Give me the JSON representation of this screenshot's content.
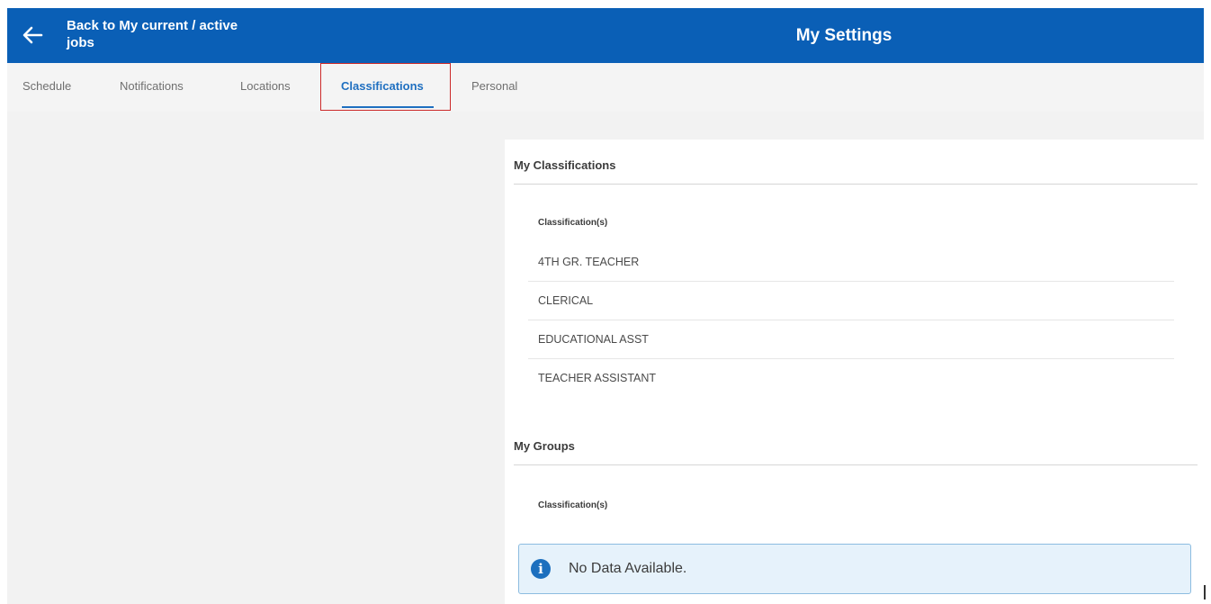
{
  "header": {
    "back_label": "Back to My current / active jobs",
    "title": "My Settings"
  },
  "tabs": [
    {
      "label": "Schedule",
      "active": false
    },
    {
      "label": "Notifications",
      "active": false
    },
    {
      "label": "Locations",
      "active": false
    },
    {
      "label": "Classifications",
      "active": true
    },
    {
      "label": "Personal",
      "active": false
    }
  ],
  "classifications": {
    "section_title": "My Classifications",
    "column_header": "Classification(s)",
    "items": [
      "4TH GR. TEACHER",
      "CLERICAL",
      "EDUCATIONAL ASST",
      "TEACHER ASSISTANT"
    ]
  },
  "groups": {
    "section_title": "My Groups",
    "column_header": "Classification(s)",
    "empty_message": "No Data Available."
  },
  "icons": {
    "back": "arrow-left-icon",
    "info": "info-icon"
  },
  "colors": {
    "header_bg": "#0a5fb6",
    "active_tab": "#1f6fc0",
    "highlight_box": "#cc2a2a",
    "info_bg": "#e6f2fb"
  }
}
